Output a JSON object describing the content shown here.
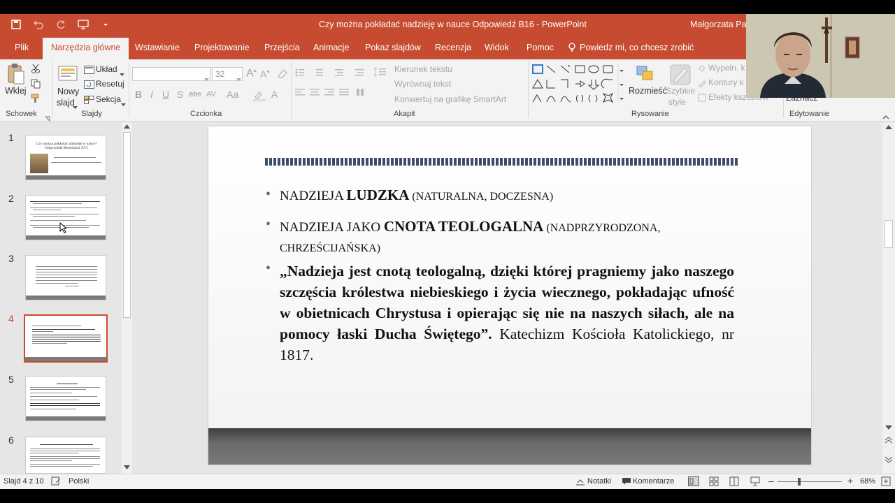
{
  "window": {
    "title": "Czy można pokładać nadzieję w nauce Odpowiedź B16  -  PowerPoint",
    "user": "Małgorzata Pag"
  },
  "tabs": [
    "Plik",
    "Narzędzia główne",
    "Wstawianie",
    "Projektowanie",
    "Przejścia",
    "Animacje",
    "Pokaz slajdów",
    "Recenzja",
    "Widok",
    "Pomoc"
  ],
  "tell_me": "Powiedz mi, co chcesz zrobić",
  "ribbon": {
    "clipboard": {
      "paste": "Wklej",
      "label": "Schowek"
    },
    "slides": {
      "new_slide_1": "Nowy",
      "new_slide_2": "slajd",
      "layout": "Układ",
      "reset": "Resetuj",
      "section": "Sekcja",
      "label": "Slajdy"
    },
    "font": {
      "font_size": "32",
      "label": "Czcionka"
    },
    "paragraph": {
      "text_direction": "Kierunek tekstu",
      "align_text": "Wyrównaj tekst",
      "smartart": "Konwertuj na grafikę SmartArt",
      "label": "Akapit"
    },
    "drawing": {
      "arrange": "Rozmieść",
      "quick_styles_1": "Szybkie",
      "quick_styles_2": "style",
      "fill": "Wypełn. k",
      "outline": "Kontury k",
      "effects": "Efekty kształtów",
      "label": "Rysowanie"
    },
    "editing": {
      "select": "Zaznacz",
      "label": "Edytowanie"
    }
  },
  "thumbnails": [
    {
      "num": "1",
      "title": "Czy można pokładać nadzieję w nauce? Odpowiedź Benedykta XVI"
    },
    {
      "num": "2"
    },
    {
      "num": "3"
    },
    {
      "num": "4"
    },
    {
      "num": "5"
    },
    {
      "num": "6"
    }
  ],
  "slide": {
    "b1": {
      "pre": "NADZIEJA ",
      "bold": "LUDZKA",
      "post": " (NATURALNA, DOCZESNA)"
    },
    "b2": {
      "pre": "NADZIEJA JAKO ",
      "bold": "CNOTA TEOLOGALNA",
      "post1": " (NADPRZYRODZONA,",
      "post2": "CHRZEŚCIJAŃSKA)"
    },
    "b3": {
      "bold": "„Nadzieja jest cnotą teologalną, dzięki której pragniemy jako naszego szczęścia królestwa niebieskiego i życia wiecznego, pokładając ufność w obietnicach Chrystusa i opierając się nie na naszych siłach, ale na pomocy łaski Ducha Świętego”.",
      "normal": "  Katechizm Kościoła Katolickiego, nr 1817."
    }
  },
  "status": {
    "slide_info": "Slajd 4 z 10",
    "language": "Polski",
    "notes": "Notatki",
    "comments": "Komentarze",
    "zoom": "68%"
  },
  "colors": {
    "accent": "#c64b30",
    "selected_thumb": "#d04a2e"
  }
}
